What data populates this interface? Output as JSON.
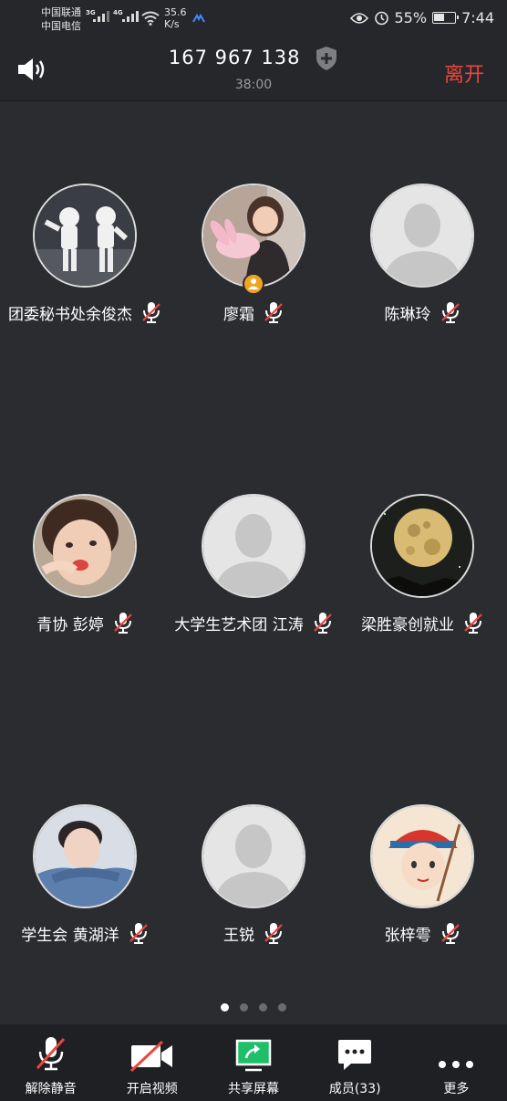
{
  "status_bar": {
    "carrier1": "中国联通",
    "carrier2": "中国电信",
    "net1": "3G",
    "net2": "4G",
    "speed_value": "35.6",
    "speed_unit": "K/s",
    "battery_percent": "55%",
    "battery_level": 0.55,
    "time": "7:44"
  },
  "header": {
    "meeting_id": "167 967 138",
    "elapsed": "38:00",
    "leave_label": "离开"
  },
  "participants": [
    {
      "name": "团委秘书处余俊杰",
      "avatar": "astronauts-photo",
      "muted": true,
      "host": false
    },
    {
      "name": "廖霜",
      "avatar": "girl-with-bunny-photo",
      "muted": true,
      "host": true
    },
    {
      "name": "陈琳玲",
      "avatar": "default-person",
      "muted": true,
      "host": false
    },
    {
      "name": "青协 彭婷",
      "avatar": "child-photo",
      "muted": true,
      "host": false
    },
    {
      "name": "大学生艺术团 江涛",
      "avatar": "default-person",
      "muted": true,
      "host": false
    },
    {
      "name": "梁胜豪创就业",
      "avatar": "moon-photo",
      "muted": true,
      "host": false
    },
    {
      "name": "学生会 黄湖洋",
      "avatar": "young-man-photo",
      "muted": true,
      "host": false
    },
    {
      "name": "王锐",
      "avatar": "default-person",
      "muted": true,
      "host": false
    },
    {
      "name": "张梓雩",
      "avatar": "cartoon-photo",
      "muted": true,
      "host": false
    }
  ],
  "pagination": {
    "pages": 4,
    "current": 1
  },
  "toolbar": {
    "unmute": "解除静音",
    "video": "开启视频",
    "share": "共享屏幕",
    "members": "成员(33)",
    "more": "更多"
  },
  "colors": {
    "background": "#2b2c30",
    "leave": "#e9463f",
    "share_green": "#1fbf6a",
    "host_badge": "#f0a521"
  }
}
